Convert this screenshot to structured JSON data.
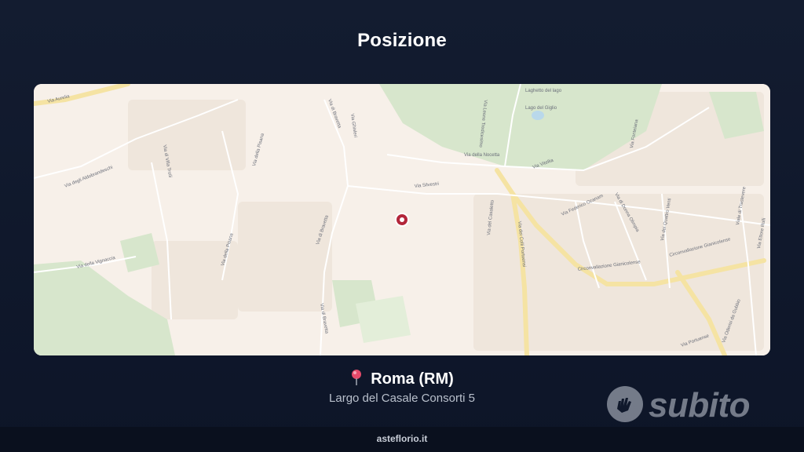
{
  "page": {
    "title": "Posizione"
  },
  "map": {
    "pin_icon": "map-marker-icon",
    "colors": {
      "background": "#f7f0e9",
      "park": "#d7e6cc",
      "major_road": "#f5e3a3",
      "water": "#b9d8ea",
      "marker": "#b3263a"
    },
    "labels": {
      "via_aurelia": "Via Aurelia",
      "via_aldobrandeschi": "Via degli Aldobrandeschi",
      "via_villa_troili": "Via di Villa Troili",
      "via_bravetta_n": "Via di Bravetta",
      "via_pisana": "Via della Pisana",
      "via_leone": "Via Leone Tredicesimo",
      "via_nocetta": "Via della Nocetta",
      "via_vitellia": "Via Vitellia",
      "via_silvestri": "Via Silvestri",
      "via_ghisleri": "Via Ghisleri",
      "via_bravetta_c": "Via di Bravetta",
      "via_pisana_s": "Via della Pisana",
      "via_vignaccia": "Via della Vignaccia",
      "via_colli_portuensi": "Via dei Colli Portuensi",
      "via_casaletto": "Via del Casaletto",
      "via_federico": "Via Federico Ozanam",
      "via_donna": "Via di Donna Olimpia",
      "circonvallazione": "Circonvallazione Gianicolense",
      "circonvallazione_e": "Circonvallazione Gianicolense",
      "via_quattro_venti": "Via dei Quattro Venti",
      "via_portuense": "Via Portuense",
      "via_oderisi": "Via Oderisi da Gubbio",
      "via_ettore_rolli": "Via Ettore Rolli",
      "via_trastevere": "Viale di Trastevere",
      "via_fonteiana": "Via Fonteiana",
      "via_bravetta_s": "Via di Bravetta",
      "lago": "Laghetto del lago",
      "lago2": "Lago del Giglio"
    }
  },
  "location": {
    "city": "Roma (RM)",
    "address": "Largo del Casale Consorti 5",
    "pin_icon": "pin-icon"
  },
  "brand": {
    "name": "subito",
    "icon": "subito-hand-icon"
  },
  "footer": {
    "text": "asteflorio.it"
  }
}
